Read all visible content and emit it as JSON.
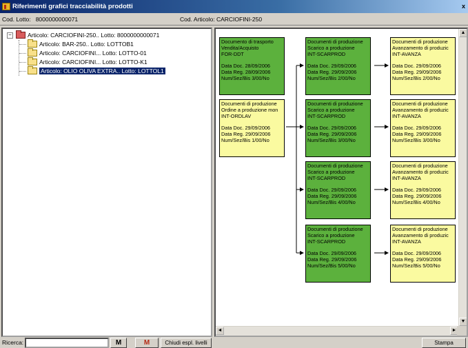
{
  "window": {
    "title": "Riferimenti grafici tracciabilità prodotti",
    "close_glyph": "x"
  },
  "info": {
    "lotto_label": "Cod. Lotto:",
    "lotto_value": "8000000000071",
    "articolo_label": "Cod. Articolo:",
    "articolo_value": "CARCIOFINI-250"
  },
  "tree": {
    "expander": "−",
    "root": "Articolo: CARCIOFINI-250.. Lotto: 8000000000071",
    "children": [
      "Articolo: BAR-250.. Lotto: LOTTOB1",
      "Articolo: CARCIOFINI... Lotto: LOTTO-01",
      "Articolo: CARCIOFINI... Lotto: LOTTO-K1",
      "Articolo: OLIO OLIVA EXTRA.. Lotto: LOTTOL1"
    ],
    "selected_index": 3
  },
  "graph": {
    "cards": [
      {
        "lines": [
          "Documento di trasporto",
          "Vendita/Acquisto",
          "FOR-DDT"
        ],
        "doc": "Data Doc.   28/09/2006",
        "reg": "Data Reg.   28/09/2006",
        "num": "Num/Sez/Bis   3/00/No",
        "color": "#5cb13d"
      },
      {
        "lines": [
          "Documenti di produzione",
          "Ordine a produzione mon",
          "INT-ORDLAV"
        ],
        "doc": "Data Doc.   29/09/2006",
        "reg": "Data Reg.   29/09/2006",
        "num": "Num/Sez/Bis   1/00/No",
        "color": "#fafaa0"
      },
      {
        "lines": [
          "Documenti di produzione",
          "Scarico a produzione",
          "INT-SCARPROD"
        ],
        "doc": "Data Doc.   29/09/2006",
        "reg": "Data Reg.   29/09/2006",
        "num": "Num/Sez/Bis   2/00/No",
        "color": "#5cb13d"
      },
      {
        "lines": [
          "Documenti di produzione",
          "Scarico a produzione",
          "INT-SCARPROD"
        ],
        "doc": "Data Doc.   29/09/2006",
        "reg": "Data Reg.   29/09/2006",
        "num": "Num/Sez/Bis   3/00/No",
        "color": "#5cb13d"
      },
      {
        "lines": [
          "Documenti di produzione",
          "Scarico a produzione",
          "INT-SCARPROD"
        ],
        "doc": "Data Doc.   29/09/2006",
        "reg": "Data Reg.   29/09/2006",
        "num": "Num/Sez/Bis   4/00/No",
        "color": "#5cb13d"
      },
      {
        "lines": [
          "Documenti di produzione",
          "Scarico a produzione",
          "INT-SCARPROD"
        ],
        "doc": "Data Doc.   29/09/2006",
        "reg": "Data Reg.   29/09/2006",
        "num": "Num/Sez/Bis   5/00/No",
        "color": "#5cb13d"
      },
      {
        "lines": [
          "Documenti di produzione",
          "Avanzamento di produzic",
          "INT-AVANZA"
        ],
        "doc": "Data Doc.   29/09/2006",
        "reg": "Data Reg.   29/09/2006",
        "num": "Num/Sez/Bis   2/00/No",
        "color": "#fafaa0"
      },
      {
        "lines": [
          "Documenti di produzione",
          "Avanzamento di produzic",
          "INT-AVANZA"
        ],
        "doc": "Data Doc.   29/09/2006",
        "reg": "Data Reg.   29/09/2006",
        "num": "Num/Sez/Bis   3/00/No",
        "color": "#fafaa0"
      },
      {
        "lines": [
          "Documenti di produzione",
          "Avanzamento di produzic",
          "INT-AVANZA"
        ],
        "doc": "Data Doc.   29/09/2006",
        "reg": "Data Reg.   29/09/2006",
        "num": "Num/Sez/Bis   4/00/No",
        "color": "#fafaa0"
      },
      {
        "lines": [
          "Documenti di produzione",
          "Avanzamento di produzic",
          "INT-AVANZA"
        ],
        "doc": "Data Doc.   29/09/2006",
        "reg": "Data Reg.   29/09/2006",
        "num": "Num/Sez/Bis   5/00/No",
        "color": "#fafaa0"
      }
    ]
  },
  "scroll": {
    "up": "▲",
    "down": "▼",
    "left": "◄",
    "right": "►"
  },
  "bottom": {
    "search_label": "Ricerca:",
    "search_value": "",
    "find_glyph": "M",
    "find_prev_glyph": "M",
    "collapse_label": "Chiudi espl. livelli",
    "print_label": "Stampa"
  }
}
